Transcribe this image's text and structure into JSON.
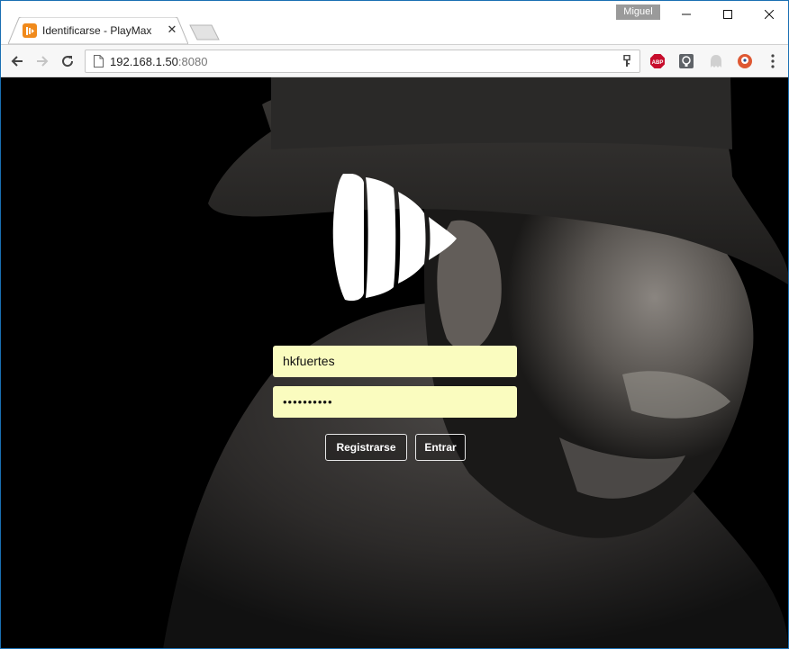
{
  "browser": {
    "profile_name": "Miguel",
    "tab": {
      "title": "Identificarse - PlayMax",
      "close_label": "✕",
      "favicon_color": "#f08a1c"
    },
    "window_controls": {
      "minimize": "—",
      "maximize": "☐",
      "close": "✕"
    },
    "address": {
      "host": "192.168.1.50",
      "port": ":8080"
    },
    "extensions": [
      "adblock-plus-icon",
      "lightbulb-icon",
      "ghostery-icon",
      "duckduckgo-icon"
    ]
  },
  "login": {
    "username_value": "hkfuertes",
    "password_value": "••••••••••",
    "register_label": "Registrarse",
    "enter_label": "Entrar",
    "field_color": "#fafcbf"
  }
}
